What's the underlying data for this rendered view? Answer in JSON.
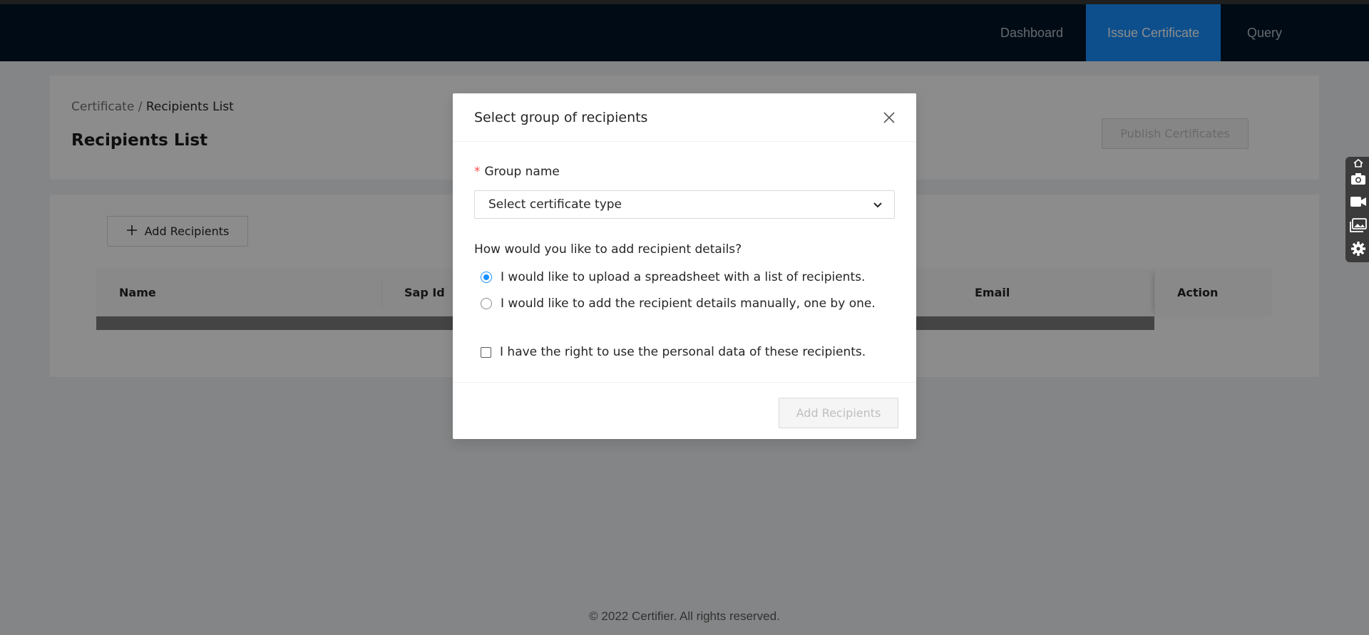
{
  "nav": {
    "items": [
      {
        "label": "Dashboard",
        "active": false
      },
      {
        "label": "Issue Certificate",
        "active": true
      },
      {
        "label": "Query",
        "active": false
      }
    ]
  },
  "breadcrumb": {
    "parent": "Certificate",
    "separator": " / ",
    "current": "Recipients List"
  },
  "page": {
    "title": "Recipients List",
    "publish_label": "Publish Certificates"
  },
  "content": {
    "add_recipients_label": "Add Recipients",
    "table": {
      "columns": [
        "Name",
        "Sap Id",
        "Email",
        "Action"
      ]
    }
  },
  "footer": {
    "text": "© 2022 Certifier. All rights reserved."
  },
  "modal": {
    "title": "Select group of recipients",
    "group_label": "Group name",
    "required_mark": "*",
    "select_placeholder": "Select certificate type",
    "question": "How would you like to add recipient details?",
    "options": [
      {
        "label": "I would like to upload a spreadsheet with a list of recipients.",
        "checked": true
      },
      {
        "label": "I would like to add the recipient details manually, one by one.",
        "checked": false
      }
    ],
    "consent_label": "I have the right to use the personal data of these recipients.",
    "consent_checked": false,
    "submit_label": "Add Recipients"
  },
  "side_toolbar": {
    "icons": [
      "home-icon",
      "camera-icon",
      "video-icon",
      "gallery-icon",
      "gear-icon"
    ]
  },
  "colors": {
    "nav_bg": "#001529",
    "accent": "#1890ff"
  }
}
